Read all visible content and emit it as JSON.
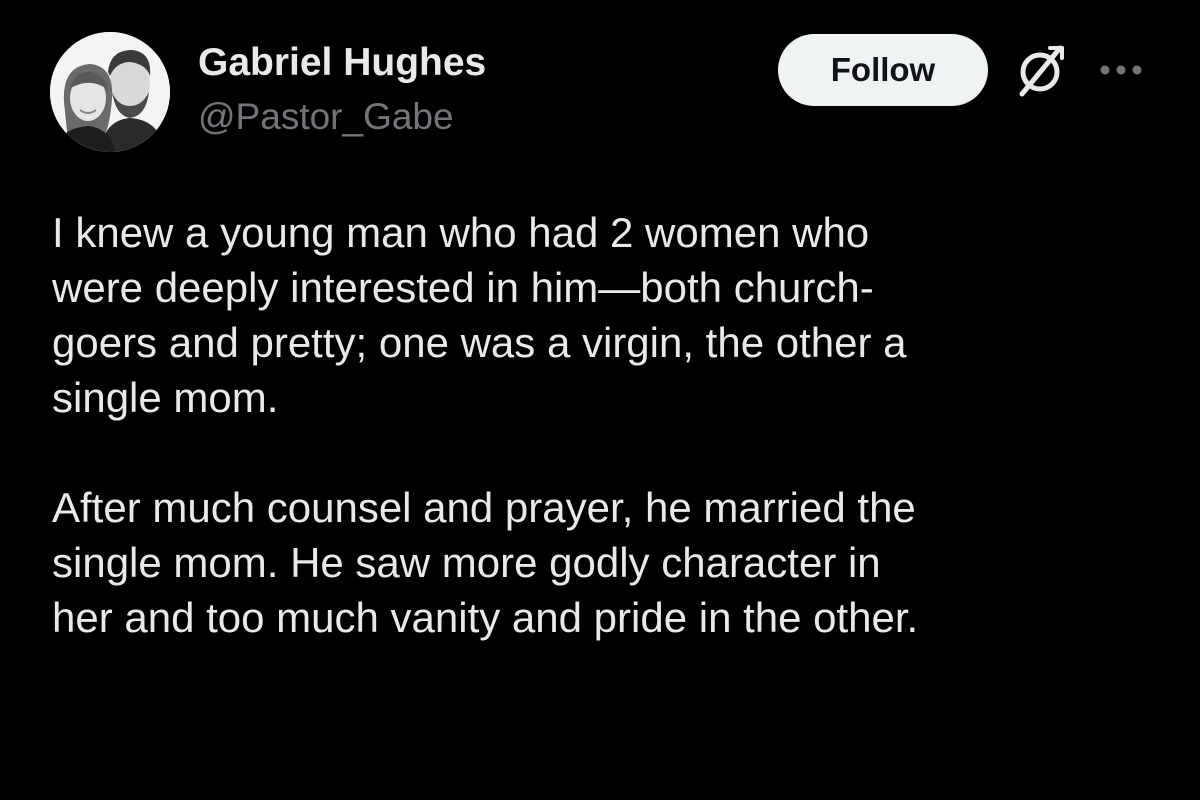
{
  "author": {
    "display_name": "Gabriel Hughes",
    "handle": "@Pastor_Gabe"
  },
  "actions": {
    "follow_label": "Follow",
    "grok_icon": "grok-icon",
    "more_icon": "more-options-icon"
  },
  "post": {
    "paragraphs": [
      {
        "lines": [
          "I knew a young man who had 2 women who",
          "were deeply interested in him—both church-",
          "goers and pretty; one was a virgin, the other a",
          "single mom."
        ]
      },
      {
        "lines": [
          "After much counsel and prayer, he married the",
          "single mom. He saw more godly character in",
          "her and too much vanity and pride in the other."
        ]
      }
    ]
  },
  "colors": {
    "background": "#000000",
    "primary_text": "#e7e9ea",
    "secondary_text": "#71767b",
    "follow_button_bg": "#eff3f4",
    "follow_button_text": "#0f1419"
  }
}
